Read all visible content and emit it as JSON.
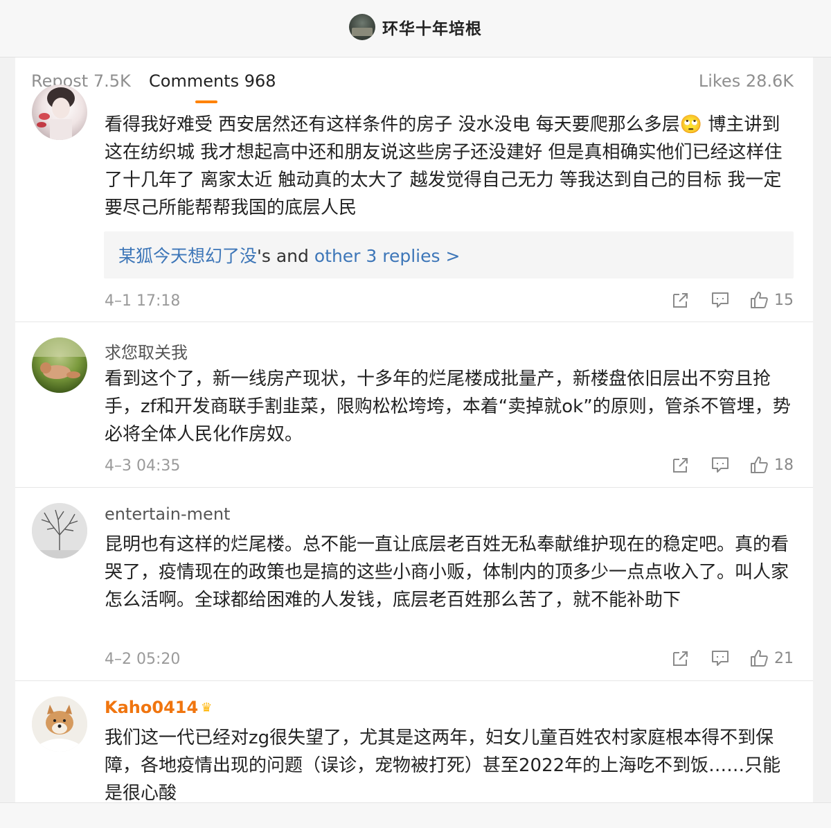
{
  "header": {
    "title": "环华十年培根",
    "avatar_icon": "profile-avatar"
  },
  "tabs": {
    "repost": "Repost 7.5K",
    "comments": "Comments 968",
    "likes": "Likes 28.6K",
    "active_color": "#ff8200"
  },
  "comments": [
    {
      "username": "",
      "text": "看得我好难受 西安居然还有这样条件的房子 没水没电 每天要爬那么多层🙄 博主讲到这在纺织城 我才想起高中还和朋友说这些房子还没建好 但是真相确实他们已经这样住了十几年了 离家太近 触动真的太大了 越发觉得自己无力 等我达到自己的目标 我一定要尽己所能帮帮我国的底层人民",
      "replies": {
        "user": "某狐今天想幻了没",
        "middle": "'s and ",
        "more": "other 3 replies >"
      },
      "time": "4–1 17:18",
      "likes": "15"
    },
    {
      "username": "求您取关我",
      "text": "看到这个了，新一线房产现状，十多年的烂尾楼成批量产，新楼盘依旧层出不穷且抢手，zf和开发商联手割韭菜，限购松松垮垮，本着“卖掉就ok”的原则，管杀不管埋，势必将全体人民化作房奴。",
      "time": "4–3 04:35",
      "likes": "18"
    },
    {
      "username": "entertain-ment",
      "text": "昆明也有这样的烂尾楼。总不能一直让底层老百姓无私奉献维护现在的稳定吧。真的看哭了，疫情现在的政策也是搞的这些小商小贩，体制内的顶多少一点点收入了。叫人家怎么活啊。全球都给困难的人发钱，底层老百姓那么苦了，就不能补助下",
      "time": "4–2 05:20",
      "likes": "21"
    },
    {
      "username": "Kaho0414",
      "badge_icon": "crown-icon",
      "badge_color": "#ffb300",
      "text": "我们这一代已经对zg很失望了，尤其是这两年，妇女儿童百姓农村家庭根本得不到保障，各地疫情出现的问题（误诊，宠物被打死）甚至2022年的上海吃不到饭……只能是很心酸"
    }
  ],
  "colors": {
    "link": "#3d76b8",
    "vip_name": "#f0750f"
  }
}
